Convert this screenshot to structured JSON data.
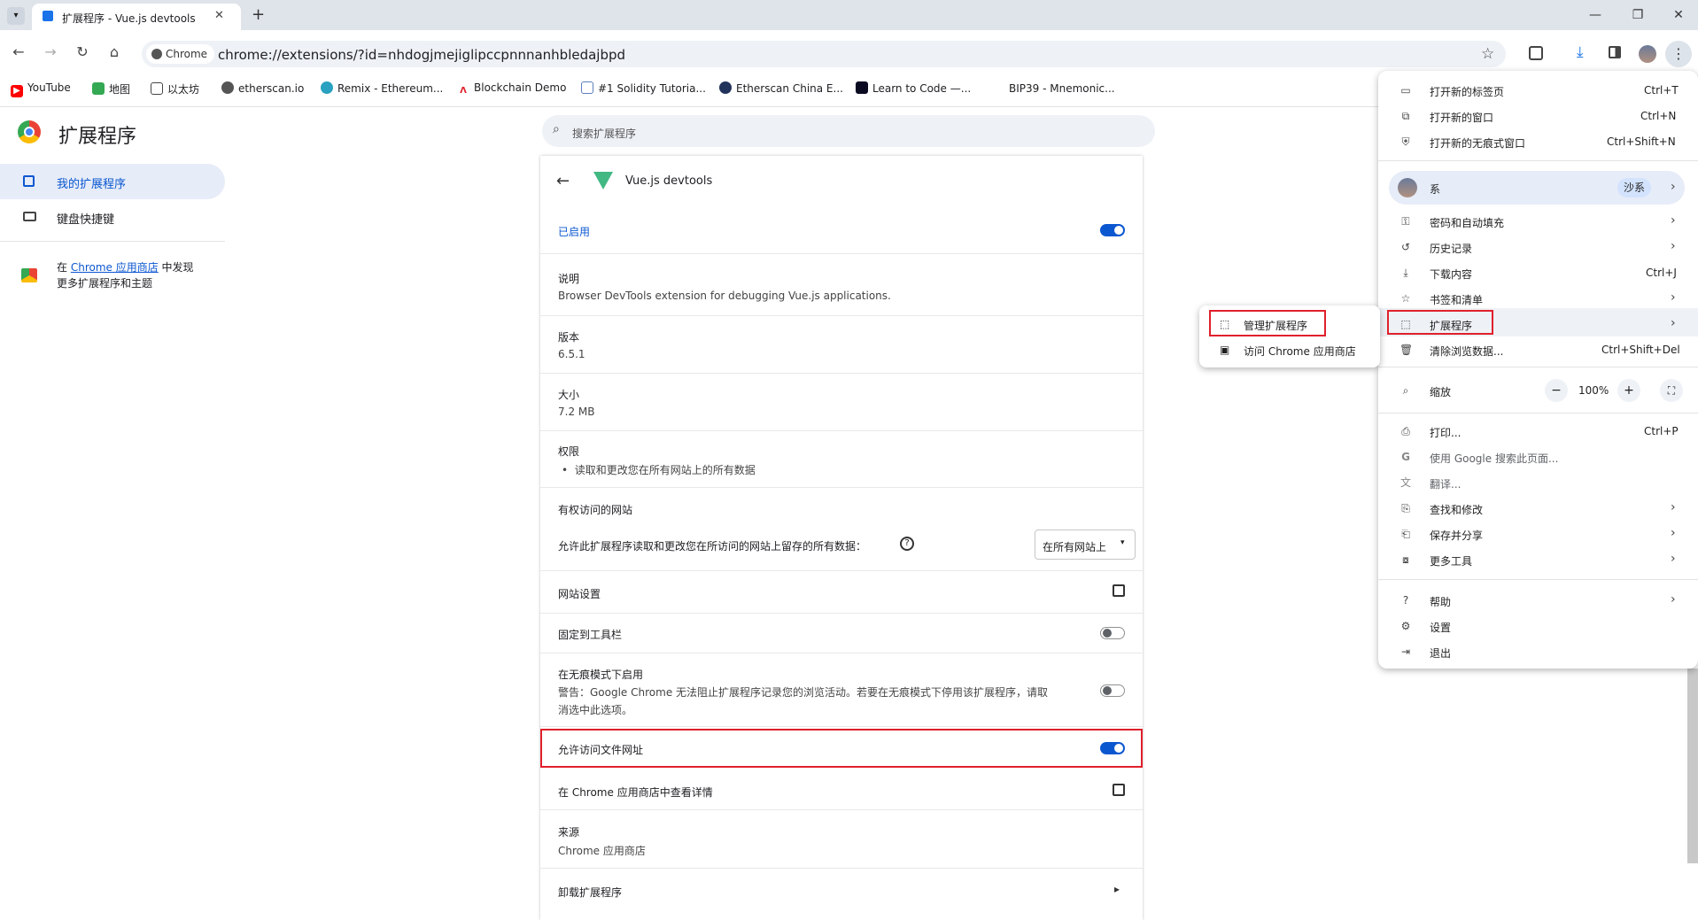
{
  "tab": {
    "title": "扩展程序 - Vue.js devtools",
    "new_tab": "+"
  },
  "window": {
    "minimize": "—",
    "restore": "❐",
    "close": "✕"
  },
  "toolbar": {
    "chip": "Chrome",
    "url": "chrome://extensions/?id=nhdogjmejiglipccpnnnanhbledajbpd"
  },
  "bookmarks": [
    "YouTube",
    "地图",
    "以太坊",
    "etherscan.io",
    "Remix - Ethereum...",
    "Blockchain Demo",
    "#1 Solidity Tutoria...",
    "Etherscan China E...",
    "Learn to Code —...",
    "BIP39 - Mnemonic..."
  ],
  "sidebar": {
    "title": "扩展程序",
    "items": [
      {
        "label": "我的扩展程序"
      },
      {
        "label": "键盘快捷键"
      }
    ],
    "store_pre": "在 ",
    "store_link": "Chrome 应用商店",
    "store_post": " 中发现",
    "store_line2": "更多扩展程序和主题"
  },
  "search": {
    "placeholder": "搜索扩展程序"
  },
  "detail": {
    "name": "Vue.js devtools",
    "enabled_label": "已启用",
    "desc_title": "说明",
    "desc": "Browser DevTools extension for debugging Vue.js applications.",
    "version_title": "版本",
    "version": "6.5.1",
    "size_title": "大小",
    "size": "7.2 MB",
    "perm_title": "权限",
    "perm_item": "读取和更改您在所有网站上的所有数据",
    "site_access_title": "有权访问的网站",
    "site_access_desc": "允许此扩展程序读取和更改您在所访问的网站上留存的所有数据：",
    "site_access_value": "在所有网站上",
    "site_settings": "网站设置",
    "pin": "固定到工具栏",
    "incognito_title": "在无痕模式下启用",
    "incognito_warn1": "警告：Google Chrome 无法阻止扩展程序记录您的浏览活动。若要在无痕模式下停用该扩展程序，请取",
    "incognito_warn2": "消选中此选项。",
    "file_urls": "允许访问文件网址",
    "store_details": "在 Chrome 应用商店中查看详情",
    "source_title": "来源",
    "source": "Chrome 应用商店",
    "uninstall": "卸载扩展程序",
    "toggles": {
      "enabled": true,
      "pin": false,
      "incognito": false,
      "file_urls": true
    }
  },
  "menu": {
    "new_tab": "打开新的标签页",
    "new_tab_key": "Ctrl+T",
    "new_window": "打开新的窗口",
    "new_window_key": "Ctrl+N",
    "incognito": "打开新的无痕式窗口",
    "incognito_key": "Ctrl+Shift+N",
    "profile_name": "系",
    "profile_badge": "沙系",
    "passwords": "密码和自动填充",
    "history": "历史记录",
    "downloads": "下载内容",
    "downloads_key": "Ctrl+J",
    "bookmarks": "书签和清单",
    "extensions": "扩展程序",
    "clear": "清除浏览数据...",
    "clear_key": "Ctrl+Shift+Del",
    "zoom": "缩放",
    "zoom_minus": "−",
    "zoom_value": "100%",
    "zoom_plus": "+",
    "print": "打印...",
    "print_key": "Ctrl+P",
    "google_search": "使用 Google 搜索此页面...",
    "translate": "翻译...",
    "find": "查找和修改",
    "save_share": "保存并分享",
    "more_tools": "更多工具",
    "help": "帮助",
    "settings": "设置",
    "exit": "退出"
  },
  "submenu": {
    "manage": "管理扩展程序",
    "visit_store": "访问 Chrome 应用商店"
  }
}
